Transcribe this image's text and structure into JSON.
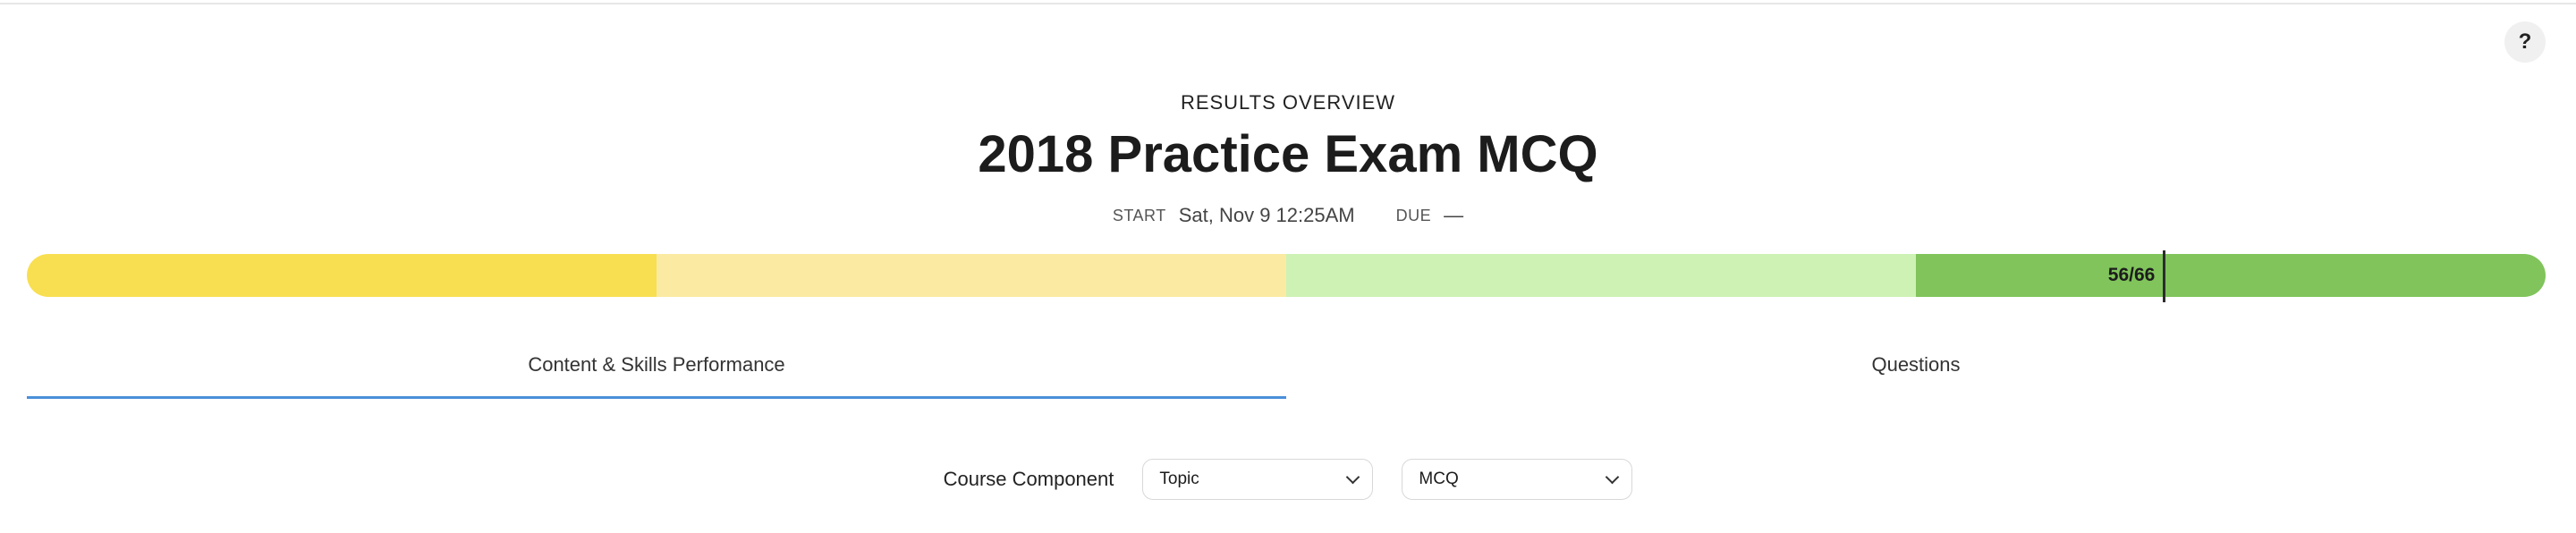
{
  "help_button": {
    "label": "?"
  },
  "header": {
    "eyebrow": "RESULTS OVERVIEW",
    "title": "2018 Practice Exam MCQ",
    "start_label": "START",
    "start_value": "Sat, Nov 9 12:25AM",
    "due_label": "DUE",
    "due_value": "—"
  },
  "progress": {
    "score_label": "56/66",
    "score": 56,
    "total": 66,
    "segments": [
      {
        "color": "#f8df52"
      },
      {
        "color": "#fbeaa2"
      },
      {
        "color": "#cdf2b4"
      },
      {
        "color": "#80c45b"
      }
    ]
  },
  "tabs": [
    {
      "label": "Content & Skills Performance",
      "active": true
    },
    {
      "label": "Questions",
      "active": false
    }
  ],
  "filters": {
    "label": "Course Component",
    "selects": [
      {
        "value": "Topic"
      },
      {
        "value": "MCQ"
      }
    ]
  },
  "colors": {
    "tab_underline": "#4a90d9"
  }
}
